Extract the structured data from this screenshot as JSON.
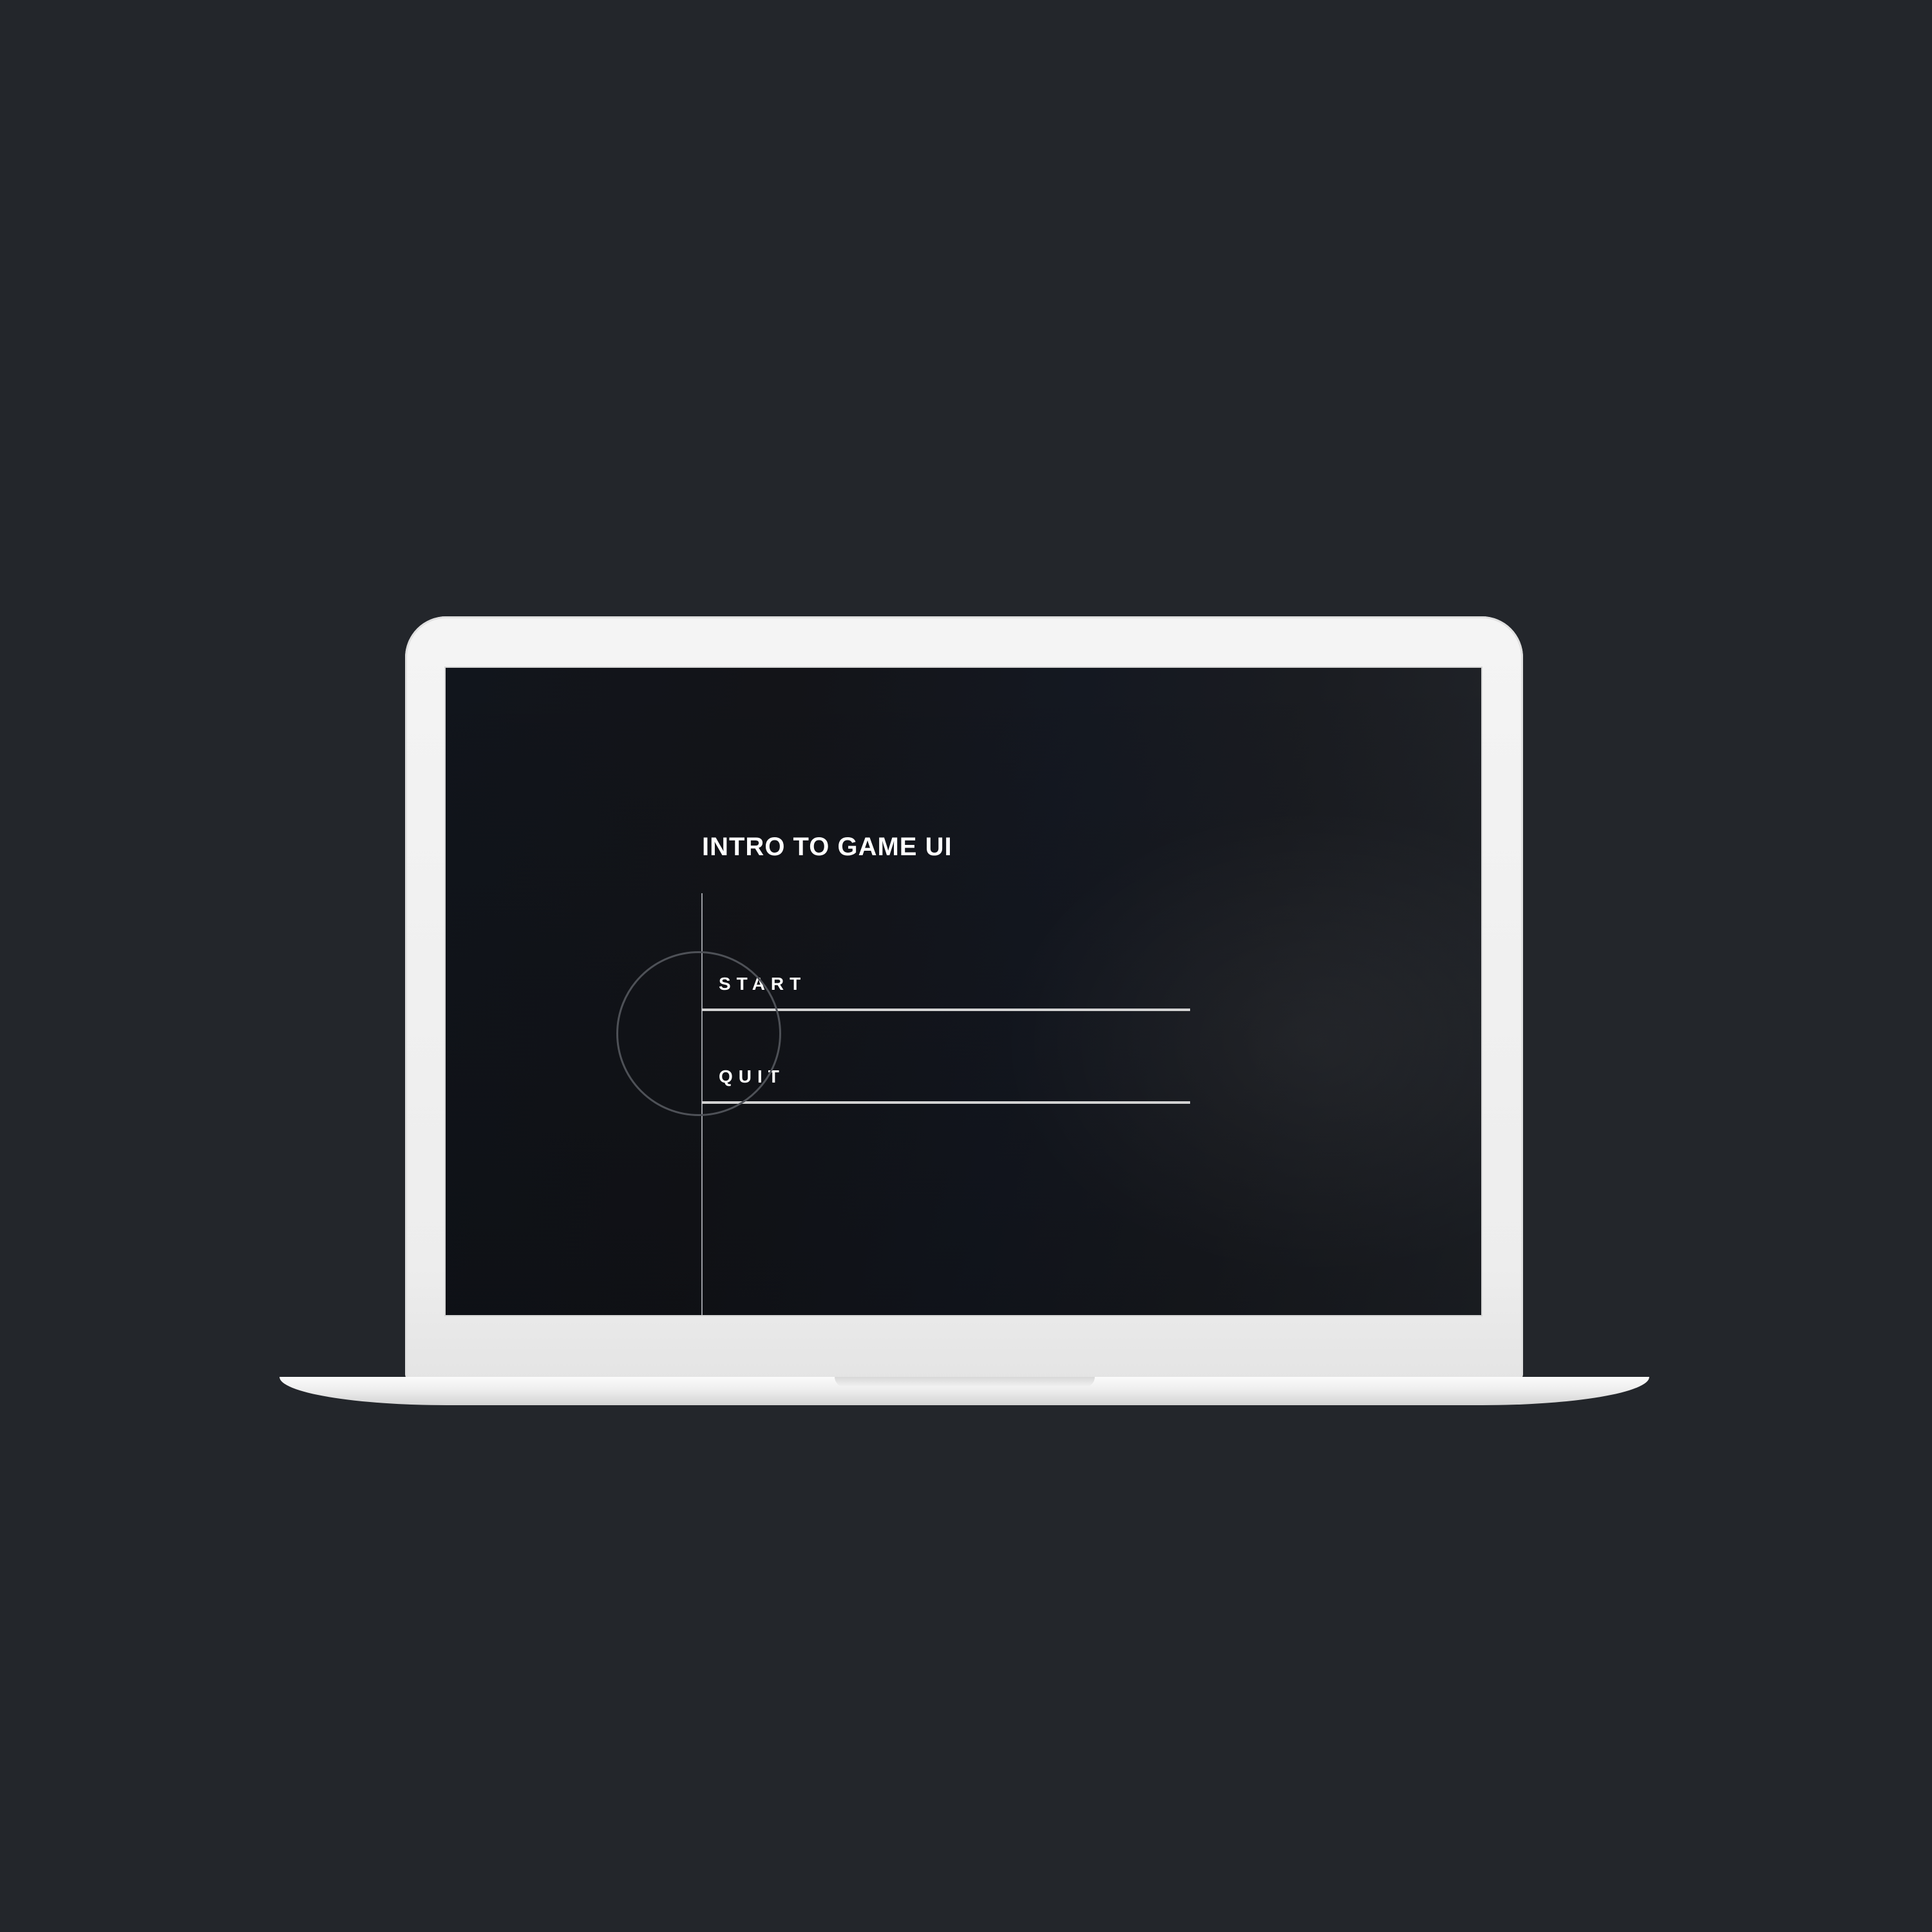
{
  "game_menu": {
    "title": "INTRO TO GAME UI",
    "items": [
      {
        "label": "START"
      },
      {
        "label": "QUIT"
      }
    ]
  },
  "colors": {
    "page_background": "#23262b",
    "device_shell": "#f2f2f2",
    "screen_background": "#131418",
    "text": "#ffffff",
    "menu_line": "#d2d2d2",
    "selector_ring": "#4e5157"
  }
}
